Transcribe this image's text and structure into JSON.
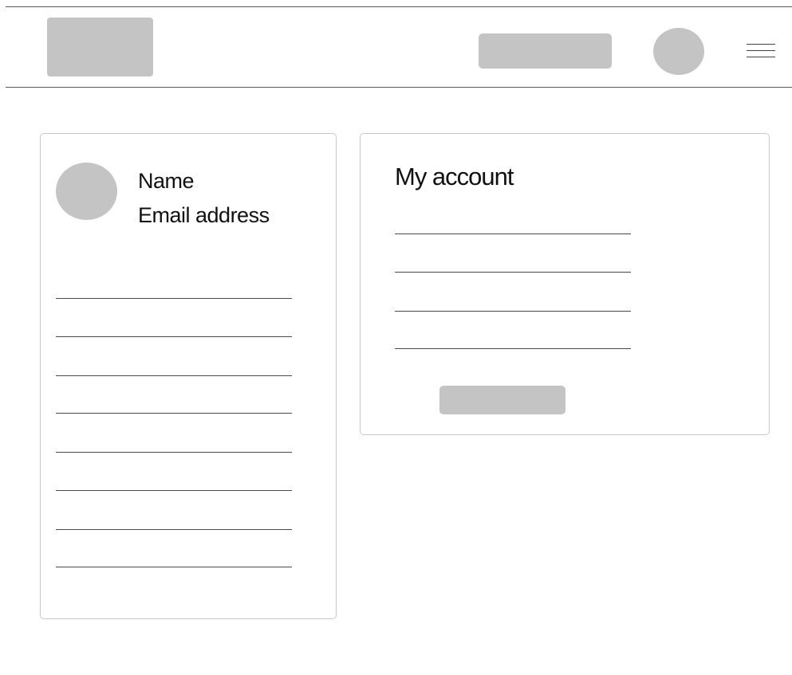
{
  "header": {
    "logo": "logo-placeholder",
    "button": "header-action-placeholder",
    "avatar": "user-avatar-placeholder",
    "menu_icon": "hamburger-menu-icon"
  },
  "profile": {
    "name": "Name",
    "email": "Email address",
    "link_count": 8
  },
  "account": {
    "title": "My account",
    "field_count": 4
  },
  "colors": {
    "placeholder": "#c4c4c4",
    "line": "#4a4a4a",
    "card_border": "#c9c9c9"
  }
}
